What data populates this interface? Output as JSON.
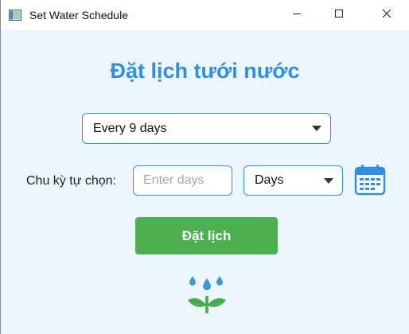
{
  "window": {
    "title": "Set Water Schedule"
  },
  "main": {
    "heading": "Đặt lịch tưới nước",
    "frequency_select": {
      "selected": "Every 9 days"
    },
    "custom": {
      "label": "Chu kỳ tự chọn:",
      "input_placeholder": "Enter days",
      "input_value": "",
      "unit_select": {
        "selected": "Days"
      }
    },
    "submit_label": "Đặt lịch"
  },
  "icons": {
    "app": "window-icon",
    "minimize": "minimize-icon",
    "maximize": "maximize-icon",
    "close": "close-icon",
    "calendar": "calendar-icon",
    "plant": "watering-plant-icon"
  },
  "colors": {
    "accent": "#2f8fe0",
    "button": "#4caf50",
    "background": "#eef6fd"
  }
}
